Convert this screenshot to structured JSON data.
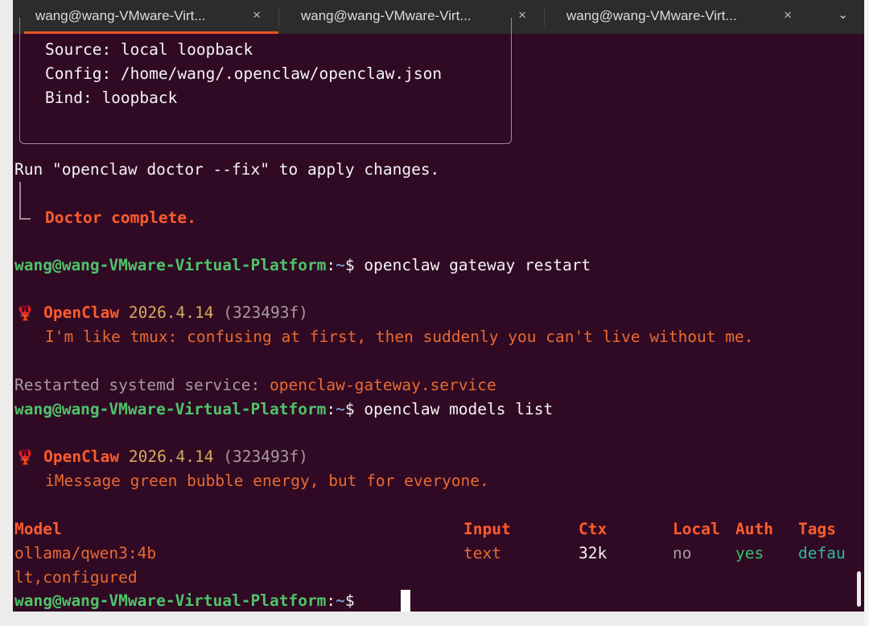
{
  "tabs": [
    {
      "title": "wang@wang-VMware-Virt...",
      "active": true
    },
    {
      "title": "wang@wang-VMware-Virt...",
      "active": false
    },
    {
      "title": "wang@wang-VMware-Virt...",
      "active": false
    }
  ],
  "tab_close_glyph": "×",
  "tab_menu_glyph": "⌄",
  "terminal": {
    "box": {
      "source": "Source: local loopback",
      "config": "Config: /home/wang/.openclaw/openclaw.json",
      "bind": "Bind: loopback"
    },
    "run_hint": "Run \"openclaw doctor --fix\" to apply changes.",
    "doctor_complete": "Doctor complete.",
    "prompt_user": "wang@wang-VMware-Virtual-Platform",
    "prompt_sep": ":",
    "prompt_path": "~",
    "prompt_dollar": "$ ",
    "cmd1": "openclaw gateway restart",
    "banner1": {
      "icon": "🦞",
      "name": "OpenClaw",
      "version": "2026.4.14",
      "hash": "(323493f)",
      "tagline": "I'm like tmux: confusing at first, then suddenly you can't live without me."
    },
    "restarted_label": "Restarted systemd service: ",
    "restarted_service": "openclaw-gateway.service",
    "cmd2": "openclaw models list",
    "banner2": {
      "icon": "🦞",
      "name": "OpenClaw",
      "version": "2026.4.14",
      "hash": "(323493f)",
      "tagline": "iMessage green bubble energy, but for everyone."
    },
    "table": {
      "headers": {
        "model": "Model",
        "input": "Input",
        "ctx": "Ctx",
        "local": "Local",
        "auth": "Auth",
        "tags": "Tags"
      },
      "row": {
        "model": "ollama/qwen3:4b",
        "input": "text",
        "ctx": "32k",
        "local": "no",
        "auth": "yes",
        "tags": "defau"
      },
      "row_wrap": "lt,configured"
    }
  },
  "colors": {
    "background": "#300a24",
    "prompt_user": "#4fc36a",
    "prompt_path": "#7896c8",
    "accent": "#ff5c2e",
    "tab_underline": "#e95420"
  }
}
